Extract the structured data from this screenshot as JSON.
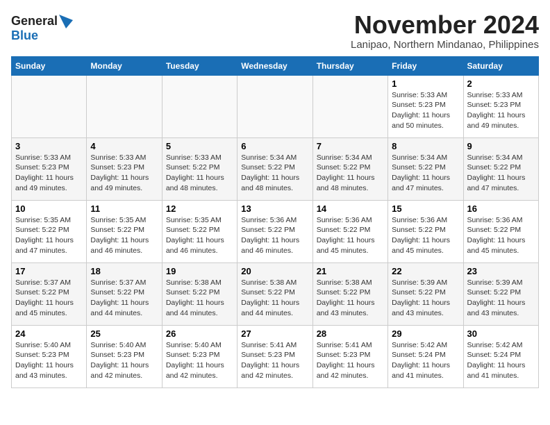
{
  "app": {
    "logo_general": "General",
    "logo_blue": "Blue"
  },
  "header": {
    "month": "November 2024",
    "location": "Lanipao, Northern Mindanao, Philippines"
  },
  "calendar": {
    "days_of_week": [
      "Sunday",
      "Monday",
      "Tuesday",
      "Wednesday",
      "Thursday",
      "Friday",
      "Saturday"
    ],
    "weeks": [
      [
        {
          "day": "",
          "info": ""
        },
        {
          "day": "",
          "info": ""
        },
        {
          "day": "",
          "info": ""
        },
        {
          "day": "",
          "info": ""
        },
        {
          "day": "",
          "info": ""
        },
        {
          "day": "1",
          "info": "Sunrise: 5:33 AM\nSunset: 5:23 PM\nDaylight: 11 hours and 50 minutes."
        },
        {
          "day": "2",
          "info": "Sunrise: 5:33 AM\nSunset: 5:23 PM\nDaylight: 11 hours and 49 minutes."
        }
      ],
      [
        {
          "day": "3",
          "info": "Sunrise: 5:33 AM\nSunset: 5:23 PM\nDaylight: 11 hours and 49 minutes."
        },
        {
          "day": "4",
          "info": "Sunrise: 5:33 AM\nSunset: 5:23 PM\nDaylight: 11 hours and 49 minutes."
        },
        {
          "day": "5",
          "info": "Sunrise: 5:33 AM\nSunset: 5:22 PM\nDaylight: 11 hours and 48 minutes."
        },
        {
          "day": "6",
          "info": "Sunrise: 5:34 AM\nSunset: 5:22 PM\nDaylight: 11 hours and 48 minutes."
        },
        {
          "day": "7",
          "info": "Sunrise: 5:34 AM\nSunset: 5:22 PM\nDaylight: 11 hours and 48 minutes."
        },
        {
          "day": "8",
          "info": "Sunrise: 5:34 AM\nSunset: 5:22 PM\nDaylight: 11 hours and 47 minutes."
        },
        {
          "day": "9",
          "info": "Sunrise: 5:34 AM\nSunset: 5:22 PM\nDaylight: 11 hours and 47 minutes."
        }
      ],
      [
        {
          "day": "10",
          "info": "Sunrise: 5:35 AM\nSunset: 5:22 PM\nDaylight: 11 hours and 47 minutes."
        },
        {
          "day": "11",
          "info": "Sunrise: 5:35 AM\nSunset: 5:22 PM\nDaylight: 11 hours and 46 minutes."
        },
        {
          "day": "12",
          "info": "Sunrise: 5:35 AM\nSunset: 5:22 PM\nDaylight: 11 hours and 46 minutes."
        },
        {
          "day": "13",
          "info": "Sunrise: 5:36 AM\nSunset: 5:22 PM\nDaylight: 11 hours and 46 minutes."
        },
        {
          "day": "14",
          "info": "Sunrise: 5:36 AM\nSunset: 5:22 PM\nDaylight: 11 hours and 45 minutes."
        },
        {
          "day": "15",
          "info": "Sunrise: 5:36 AM\nSunset: 5:22 PM\nDaylight: 11 hours and 45 minutes."
        },
        {
          "day": "16",
          "info": "Sunrise: 5:36 AM\nSunset: 5:22 PM\nDaylight: 11 hours and 45 minutes."
        }
      ],
      [
        {
          "day": "17",
          "info": "Sunrise: 5:37 AM\nSunset: 5:22 PM\nDaylight: 11 hours and 45 minutes."
        },
        {
          "day": "18",
          "info": "Sunrise: 5:37 AM\nSunset: 5:22 PM\nDaylight: 11 hours and 44 minutes."
        },
        {
          "day": "19",
          "info": "Sunrise: 5:38 AM\nSunset: 5:22 PM\nDaylight: 11 hours and 44 minutes."
        },
        {
          "day": "20",
          "info": "Sunrise: 5:38 AM\nSunset: 5:22 PM\nDaylight: 11 hours and 44 minutes."
        },
        {
          "day": "21",
          "info": "Sunrise: 5:38 AM\nSunset: 5:22 PM\nDaylight: 11 hours and 43 minutes."
        },
        {
          "day": "22",
          "info": "Sunrise: 5:39 AM\nSunset: 5:22 PM\nDaylight: 11 hours and 43 minutes."
        },
        {
          "day": "23",
          "info": "Sunrise: 5:39 AM\nSunset: 5:22 PM\nDaylight: 11 hours and 43 minutes."
        }
      ],
      [
        {
          "day": "24",
          "info": "Sunrise: 5:40 AM\nSunset: 5:23 PM\nDaylight: 11 hours and 43 minutes."
        },
        {
          "day": "25",
          "info": "Sunrise: 5:40 AM\nSunset: 5:23 PM\nDaylight: 11 hours and 42 minutes."
        },
        {
          "day": "26",
          "info": "Sunrise: 5:40 AM\nSunset: 5:23 PM\nDaylight: 11 hours and 42 minutes."
        },
        {
          "day": "27",
          "info": "Sunrise: 5:41 AM\nSunset: 5:23 PM\nDaylight: 11 hours and 42 minutes."
        },
        {
          "day": "28",
          "info": "Sunrise: 5:41 AM\nSunset: 5:23 PM\nDaylight: 11 hours and 42 minutes."
        },
        {
          "day": "29",
          "info": "Sunrise: 5:42 AM\nSunset: 5:24 PM\nDaylight: 11 hours and 41 minutes."
        },
        {
          "day": "30",
          "info": "Sunrise: 5:42 AM\nSunset: 5:24 PM\nDaylight: 11 hours and 41 minutes."
        }
      ]
    ]
  }
}
